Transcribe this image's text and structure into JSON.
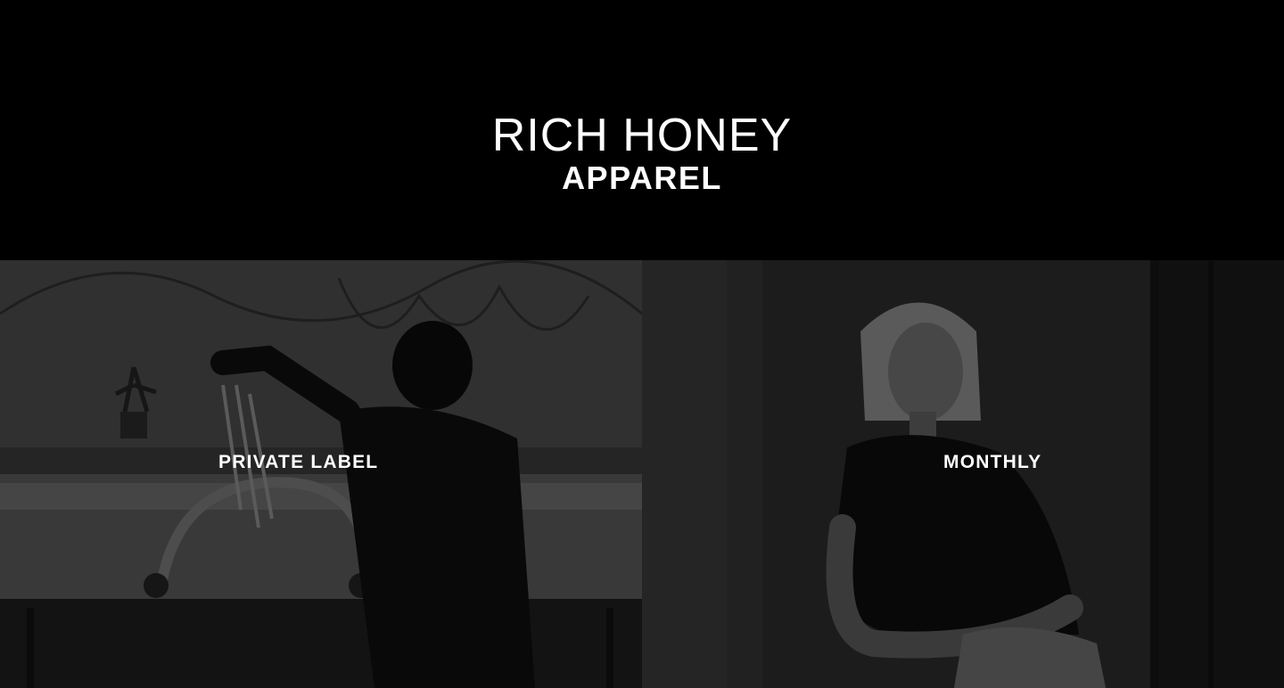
{
  "brand": {
    "title": "RICH HONEY",
    "subtitle": "APPAREL"
  },
  "panels": [
    {
      "label": "PRIVATE LABEL",
      "image": "factory-worker-photo"
    },
    {
      "label": "MONTHLY",
      "image": "model-portrait-photo"
    }
  ],
  "colors": {
    "background": "#000000",
    "text": "#ffffff"
  }
}
